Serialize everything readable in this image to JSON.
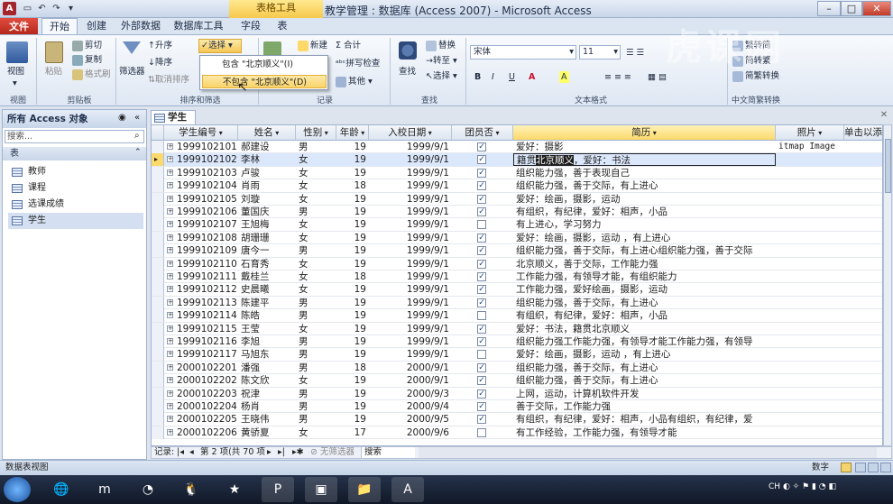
{
  "window": {
    "title": "教学管理 : 数据库 (Access 2007)  -  Microsoft Access",
    "context_tab": "表格工具",
    "app_icon": "A"
  },
  "tabs": [
    "文件",
    "开始",
    "创建",
    "外部数据",
    "数据库工具",
    "字段",
    "表"
  ],
  "ribbon": {
    "view": "视图",
    "paste": "粘贴",
    "cut": "剪切",
    "copy": "复制",
    "format_painter": "格式刷",
    "filter": "筛选器",
    "asc": "升序",
    "desc": "降序",
    "clear_sort": "取消排序",
    "selection": "选择",
    "new": "新建",
    "total": "合计",
    "spelling": "拼写检查",
    "other": "其他",
    "find": "查找",
    "replace": "替换",
    "goto": "转至",
    "select": "选择",
    "font": "宋体",
    "font_size": "11",
    "trad_to_simp": "繁转简",
    "simp_to_trad": "简转繁",
    "convert": "简繁转换",
    "bold": "B",
    "italic": "I",
    "underline": "U",
    "font_color": "A",
    "highlight": "A"
  },
  "group_labels": {
    "view": "视图",
    "clipboard": "剪贴板",
    "sort_filter": "排序和筛选",
    "records": "记录",
    "find": "查找",
    "text_format": "文本格式",
    "chinese": "中文简繁转换"
  },
  "dropdown": {
    "contains": "包含 \"北京顺义\"(I)",
    "not_contains": "不包含 \"北京顺义\"(D)"
  },
  "nav": {
    "title": "所有 Access 对象",
    "search_placeholder": "搜索...",
    "section": "表",
    "items": [
      "教师",
      "课程",
      "选课成绩",
      "学生"
    ]
  },
  "document_tab": "学生",
  "columns": [
    "学生编号",
    "姓名",
    "性别",
    "年龄",
    "入校日期",
    "团员否",
    "简历",
    "照片",
    "单击以添加"
  ],
  "rows": [
    [
      "1999102101",
      "郝建设",
      "男",
      "19",
      "1999/9/1",
      true,
      "爱好：摄影",
      "itmap Image"
    ],
    [
      "1999102102",
      "李林",
      "女",
      "19",
      "1999/9/1",
      true,
      "籍贯北京顺义，爱好：书法",
      ""
    ],
    [
      "1999102103",
      "卢骏",
      "女",
      "19",
      "1999/9/1",
      true,
      "组织能力强，善于表现自己",
      ""
    ],
    [
      "1999102104",
      "肖雨",
      "女",
      "18",
      "1999/9/1",
      true,
      "组织能力强，善于交际，有上进心",
      ""
    ],
    [
      "1999102105",
      "刘璇",
      "女",
      "19",
      "1999/9/1",
      true,
      "爱好：绘画，摄影，运动",
      ""
    ],
    [
      "1999102106",
      "董国庆",
      "男",
      "19",
      "1999/9/1",
      true,
      "有组织，有纪律，爱好：相声，小品",
      ""
    ],
    [
      "1999102107",
      "王旭梅",
      "女",
      "19",
      "1999/9/1",
      false,
      "有上进心，学习努力",
      ""
    ],
    [
      "1999102108",
      "胡珊珊",
      "女",
      "19",
      "1999/9/1",
      true,
      "爱好：绘画，摄影，运动 ，有上进心",
      ""
    ],
    [
      "1999102109",
      "唐今一",
      "男",
      "19",
      "1999/9/1",
      true,
      "组织能力强，善于交际，有上进心组织能力强，善于交际",
      ""
    ],
    [
      "1999102110",
      "石育秀",
      "女",
      "19",
      "1999/9/1",
      true,
      "北京顺义，善于交际，工作能力强",
      ""
    ],
    [
      "1999102111",
      "戴桂兰",
      "女",
      "18",
      "1999/9/1",
      true,
      "工作能力强，有领导才能，有组织能力",
      ""
    ],
    [
      "1999102112",
      "史晨曦",
      "女",
      "19",
      "1999/9/1",
      true,
      "工作能力强，爱好绘画，摄影，运动",
      ""
    ],
    [
      "1999102113",
      "陈建平",
      "男",
      "19",
      "1999/9/1",
      true,
      "组织能力强，善于交际，有上进心",
      ""
    ],
    [
      "1999102114",
      "陈皓",
      "男",
      "19",
      "1999/9/1",
      false,
      "有组织，有纪律，爱好：相声，小品",
      ""
    ],
    [
      "1999102115",
      "王莹",
      "女",
      "19",
      "1999/9/1",
      true,
      "爱好：书法，籍贯北京顺义",
      ""
    ],
    [
      "1999102116",
      "李旭",
      "男",
      "19",
      "1999/9/1",
      true,
      "组织能力强工作能力强，有领导才能工作能力强，有领导",
      ""
    ],
    [
      "1999102117",
      "马旭东",
      "男",
      "19",
      "1999/9/1",
      false,
      "爱好：绘画，摄影，运动 ，有上进心",
      ""
    ],
    [
      "2000102201",
      "潘强",
      "男",
      "18",
      "2000/9/1",
      true,
      "组织能力强，善于交际，有上进心",
      ""
    ],
    [
      "2000102202",
      "陈文欣",
      "女",
      "19",
      "2000/9/1",
      true,
      "组织能力强，善于交际，有上进心",
      ""
    ],
    [
      "2000102203",
      "祝津",
      "男",
      "19",
      "2000/9/3",
      true,
      "上网，运动，计算机软件开发",
      ""
    ],
    [
      "2000102204",
      "杨肖",
      "男",
      "19",
      "2000/9/4",
      true,
      "善于交际，工作能力强",
      ""
    ],
    [
      "2000102205",
      "王晓伟",
      "男",
      "19",
      "2000/9/5",
      true,
      "有组织，有纪律，爱好：相声，小品有组织，有纪律，爱",
      ""
    ],
    [
      "2000102206",
      "黄骄夏",
      "女",
      "17",
      "2000/9/6",
      false,
      "有工作经验，工作能力强，有领导才能",
      ""
    ]
  ],
  "edit_cell": {
    "before": "籍贯",
    "highlight": "北京顺义",
    "after": "，爱好：书法"
  },
  "record_nav": {
    "label": "记录:",
    "position": "第 2 项(共 70 项",
    "filter": "无筛选器",
    "search": "搜索"
  },
  "status": {
    "left": "数据表视图",
    "right": "数字"
  },
  "watermark": "虎课网",
  "taskbar": [
    "🌐",
    "m",
    "◔",
    "🐧",
    "★",
    "P",
    "▣",
    "📁",
    "A"
  ],
  "tray": {
    "lang": "CH"
  }
}
